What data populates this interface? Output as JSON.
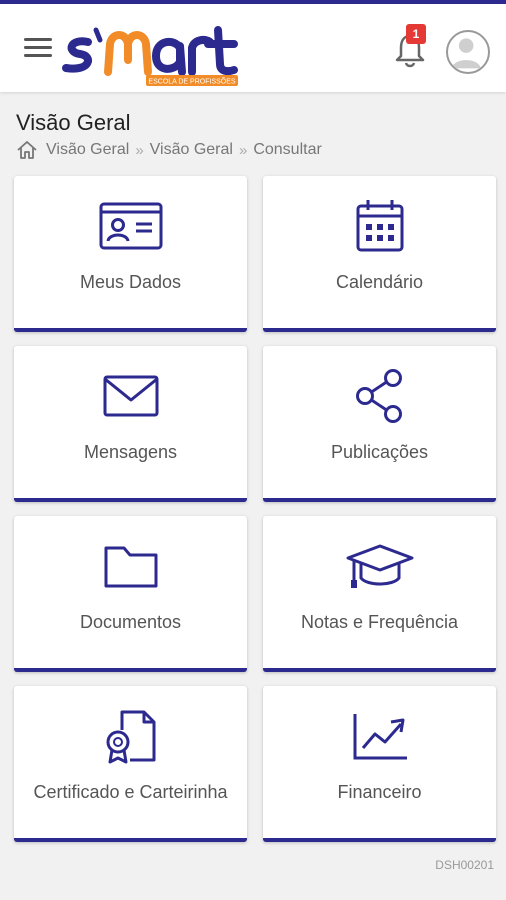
{
  "header": {
    "logo_text": "s'mart",
    "logo_subtitle": "ESCOLA DE PROFISSÕES",
    "notification_count": "1"
  },
  "page": {
    "title": "Visão Geral",
    "breadcrumb": [
      "Visão Geral",
      "Visão Geral",
      "Consultar"
    ]
  },
  "tiles": [
    {
      "label": "Meus Dados",
      "icon": "id-card-icon"
    },
    {
      "label": "Calendário",
      "icon": "calendar-icon"
    },
    {
      "label": "Mensagens",
      "icon": "envelope-icon"
    },
    {
      "label": "Publicações",
      "icon": "share-icon"
    },
    {
      "label": "Documentos",
      "icon": "folder-icon"
    },
    {
      "label": "Notas e Frequência",
      "icon": "graduation-cap-icon"
    },
    {
      "label": "Certificado e Carteirinha",
      "icon": "certificate-icon"
    },
    {
      "label": "Financeiro",
      "icon": "trend-chart-icon"
    }
  ],
  "footer": {
    "code": "DSH00201"
  },
  "colors": {
    "accent": "#2d2a8f",
    "logo_orange": "#f28c28",
    "badge": "#e53935"
  }
}
